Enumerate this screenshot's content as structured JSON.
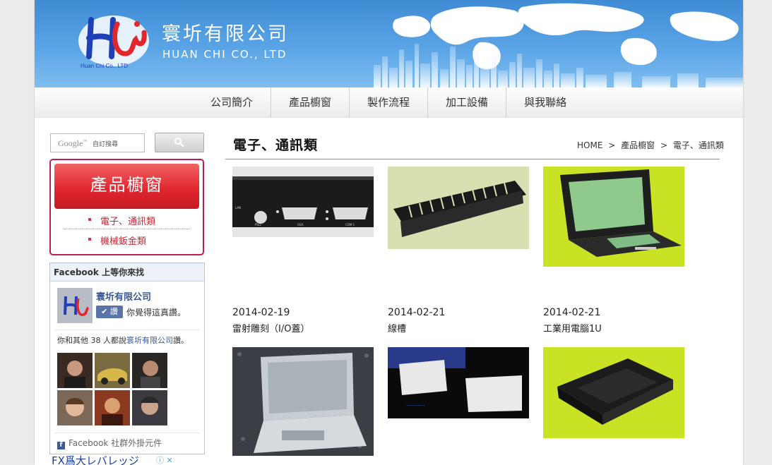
{
  "brand": {
    "name_zh": "寰圻有限公司",
    "name_en": "HUAN CHI CO., LTD",
    "logo_caption": "Huan Chi Co., LTD"
  },
  "nav": {
    "items": [
      "公司簡介",
      "產品櫥窗",
      "製作流程",
      "加工設備",
      "與我聯絡"
    ]
  },
  "search": {
    "brand": "Google",
    "placeholder": "自訂搜尋",
    "button_icon": "search-icon"
  },
  "product_menu": {
    "title": "產品櫥窗",
    "categories": [
      "電子、通訊類",
      "機械鈑金類"
    ]
  },
  "facebook": {
    "header": "Facebook 上等你來找",
    "page_name": "寰圻有限公司",
    "like_button": "讚",
    "like_text": "你覺得這真讚。",
    "count_prefix": "你和其他 38 人都說",
    "count_link": "寰圻有限公司",
    "count_suffix": "讚。",
    "footer": "Facebook 社群外掛元件"
  },
  "ad": {
    "text": "FX爲大レバレッジ"
  },
  "main": {
    "title": "電子、通訊類",
    "breadcrumb": [
      "HOME",
      "產品櫥窗",
      "電子、通訊類"
    ],
    "breadcrumb_sep": ">",
    "products": [
      {
        "date": "2014-02-19",
        "name": "雷射雕刻（I/O蓋）"
      },
      {
        "date": "2014-02-21",
        "name": "線槽"
      },
      {
        "date": "2014-02-21",
        "name": "工業用電腦1U"
      },
      {
        "date": "",
        "name": ""
      },
      {
        "date": "",
        "name": ""
      },
      {
        "date": "",
        "name": ""
      }
    ]
  },
  "colors": {
    "banner_blue": "#3f8bd4",
    "menu_red": "#e0242e",
    "menu_border": "#b92150",
    "facebook_blue": "#3b5998",
    "category_text": "#c0293a"
  }
}
